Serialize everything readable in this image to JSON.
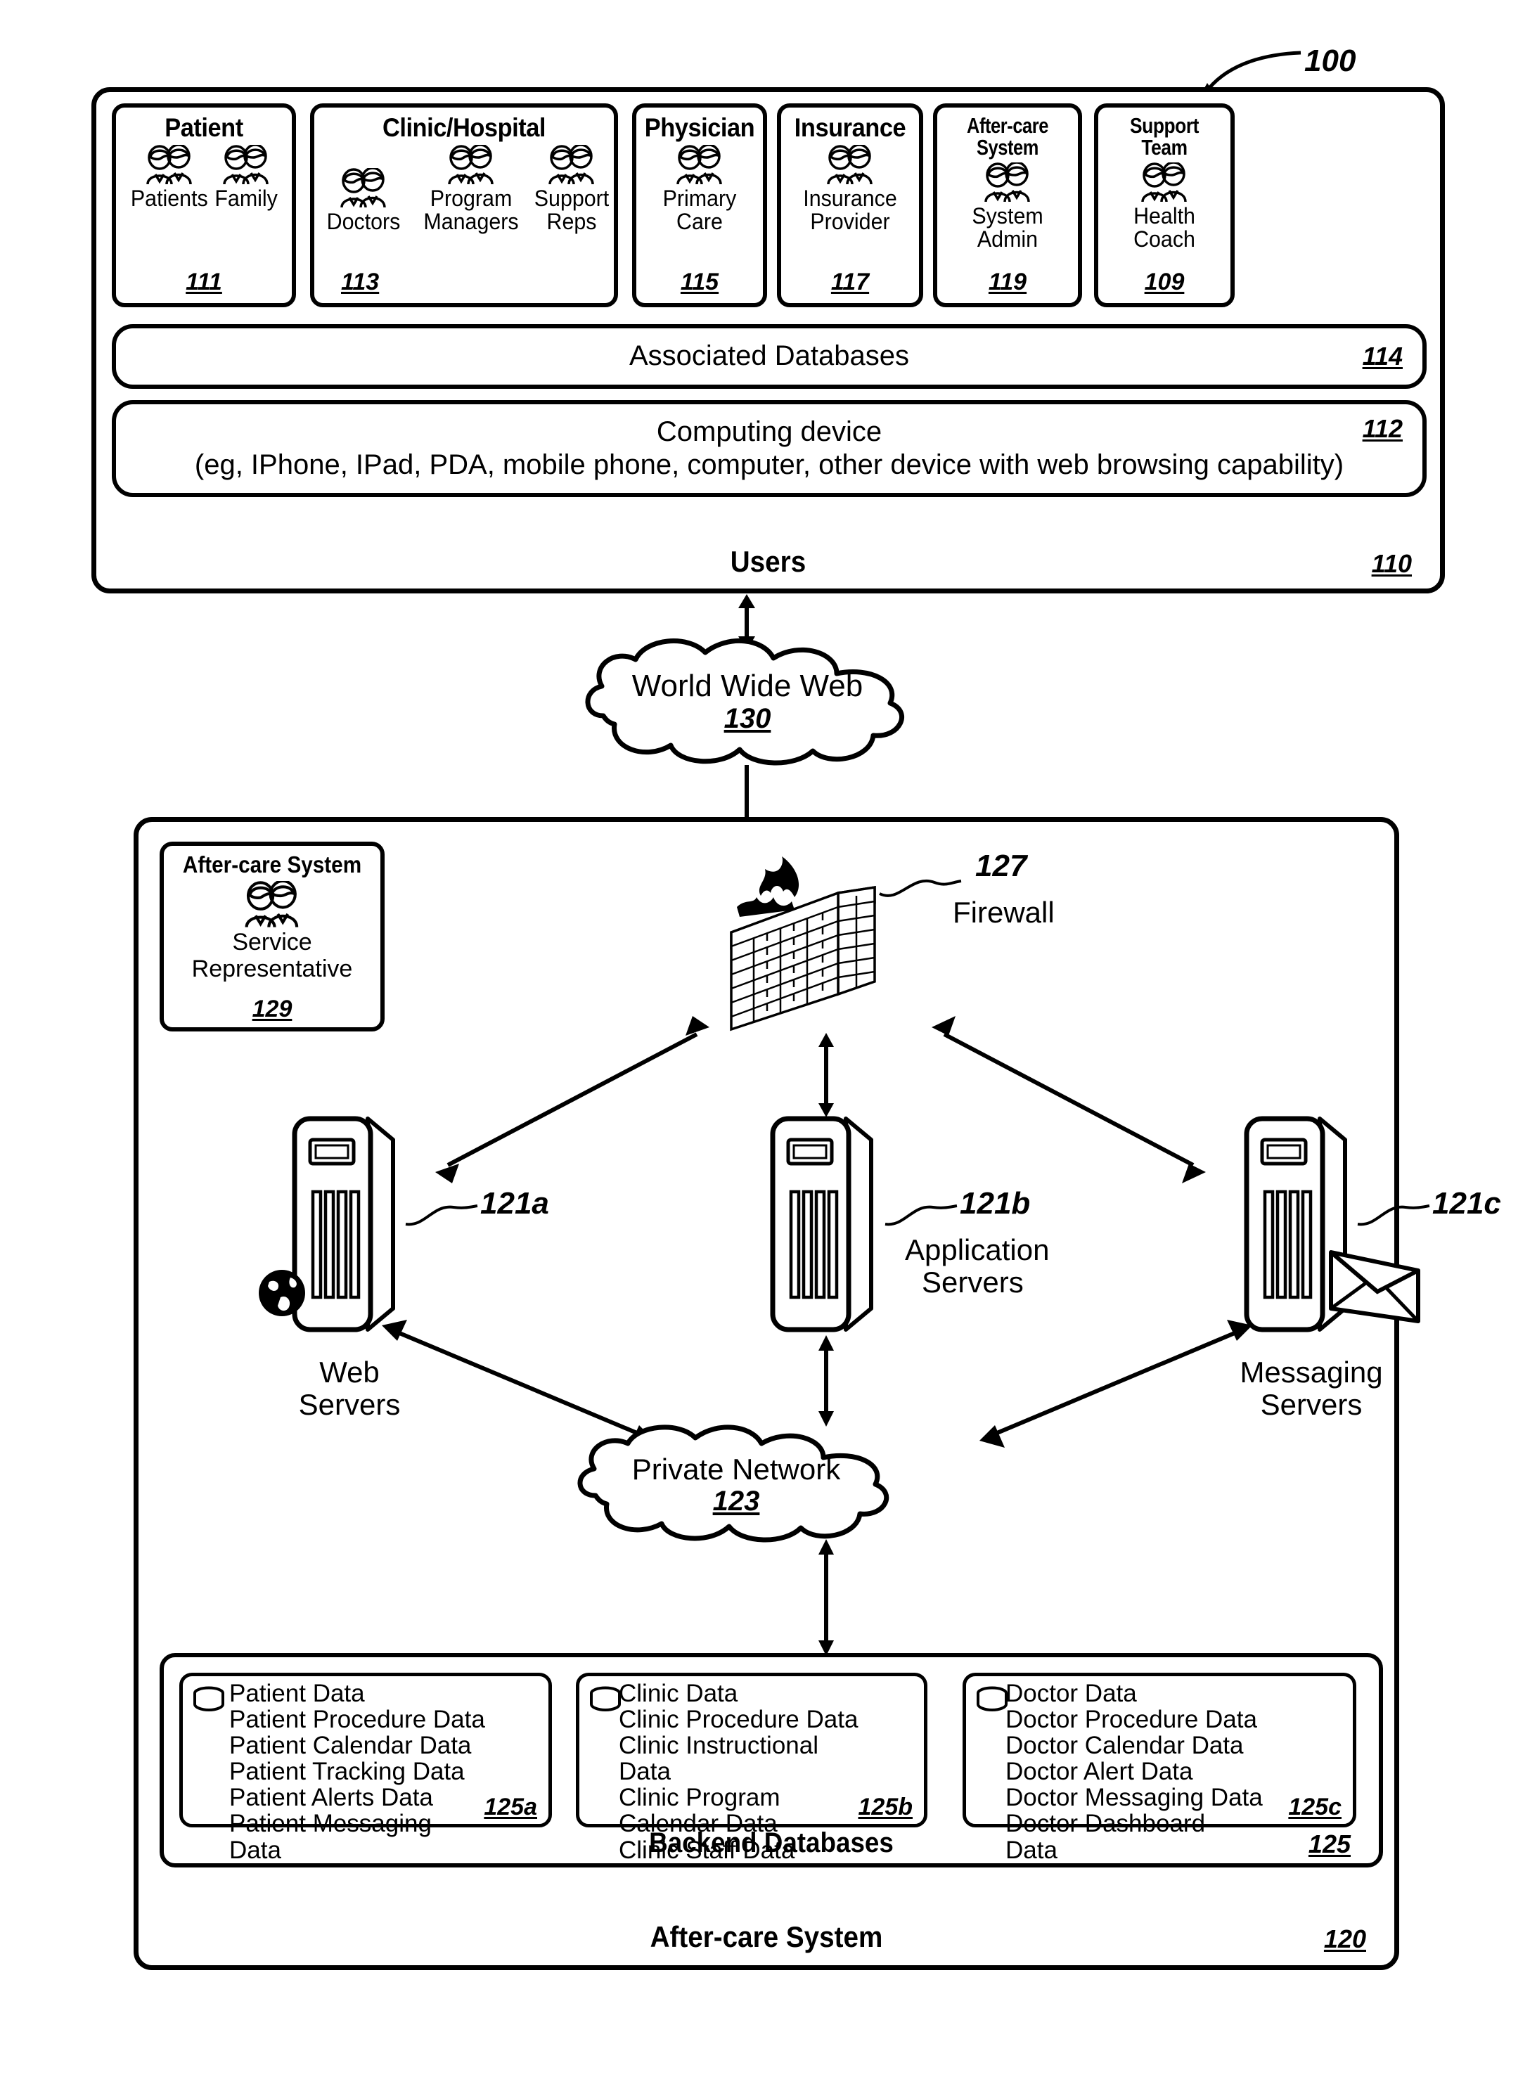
{
  "figure": {
    "ref_top": "100"
  },
  "users": {
    "title": "Users",
    "ref": "110",
    "cards": [
      {
        "title": "Patient",
        "ref": "111",
        "people": [
          {
            "label": "Patients",
            "icon": "people-icon"
          },
          {
            "label": "Family",
            "icon": "people-icon"
          }
        ]
      },
      {
        "title": "Clinic/Hospital",
        "ref": "113",
        "people": [
          {
            "label": "Doctors",
            "icon": "people-icon"
          },
          {
            "label": "Program Managers",
            "icon": "people-icon"
          },
          {
            "label": "Support Reps",
            "icon": "people-icon"
          }
        ]
      },
      {
        "title": "Physician",
        "ref": "115",
        "people": [
          {
            "label": "Primary Care",
            "icon": "people-icon"
          }
        ]
      },
      {
        "title": "Insurance",
        "ref": "117",
        "people": [
          {
            "label": "Insurance Provider",
            "icon": "people-icon"
          }
        ]
      },
      {
        "title": "After-care System",
        "ref": "119",
        "people": [
          {
            "label": "System Admin",
            "icon": "people-icon"
          }
        ]
      },
      {
        "title": "Support Team",
        "ref": "109",
        "people": [
          {
            "label": "Health Coach",
            "icon": "people-icon"
          }
        ]
      }
    ],
    "databases_row": {
      "label": "Associated Databases",
      "ref": "114"
    },
    "device_row": {
      "line1": "Computing device",
      "line2": "(eg, IPhone, IPad, PDA, mobile phone, computer, other device with web browsing capability)",
      "ref": "112"
    }
  },
  "www_cloud": {
    "label": "World Wide Web",
    "ref": "130",
    "icon": "cloud-icon"
  },
  "system": {
    "title": "After-care System",
    "ref": "120",
    "service_rep": {
      "title": "After-care System",
      "line1": "Service",
      "line2": "Representative",
      "ref": "129",
      "icon": "people-icon"
    },
    "firewall": {
      "ref": "127",
      "label": "Firewall",
      "icon": "firewall-brick-icon"
    },
    "servers": [
      {
        "ref": "121a",
        "line1": "Web",
        "line2": "Servers",
        "icon": "server-tower-icon",
        "badge": "globe-icon"
      },
      {
        "ref": "121b",
        "line1": "Application",
        "line2": "Servers",
        "icon": "server-tower-icon",
        "badge": ""
      },
      {
        "ref": "121c",
        "line1": "Messaging",
        "line2": "Servers",
        "icon": "server-tower-icon",
        "badge": "envelope-icon"
      }
    ],
    "private_cloud": {
      "label": "Private Network",
      "ref": "123",
      "icon": "cloud-icon"
    },
    "backend": {
      "title": "Backend Databases",
      "ref": "125",
      "cards": [
        {
          "ref": "125a",
          "icon": "database-cylinder-icon",
          "items": [
            "Patient Data",
            "Patient Procedure Data",
            "Patient Calendar Data",
            "Patient Tracking Data",
            "Patient Alerts Data",
            "Patient Messaging",
            "Data"
          ]
        },
        {
          "ref": "125b",
          "icon": "database-cylinder-icon",
          "items": [
            "Clinic Data",
            "Clinic Procedure Data",
            "Clinic Instructional",
            "Data",
            "Clinic Program",
            "Calendar Data",
            "Clinic Staff Data"
          ]
        },
        {
          "ref": "125c",
          "icon": "database-cylinder-icon",
          "items": [
            "Doctor Data",
            "Doctor Procedure Data",
            "Doctor Calendar Data",
            "Doctor Alert Data",
            "Doctor Messaging Data",
            "Doctor Dashboard",
            "Data"
          ]
        }
      ]
    }
  }
}
